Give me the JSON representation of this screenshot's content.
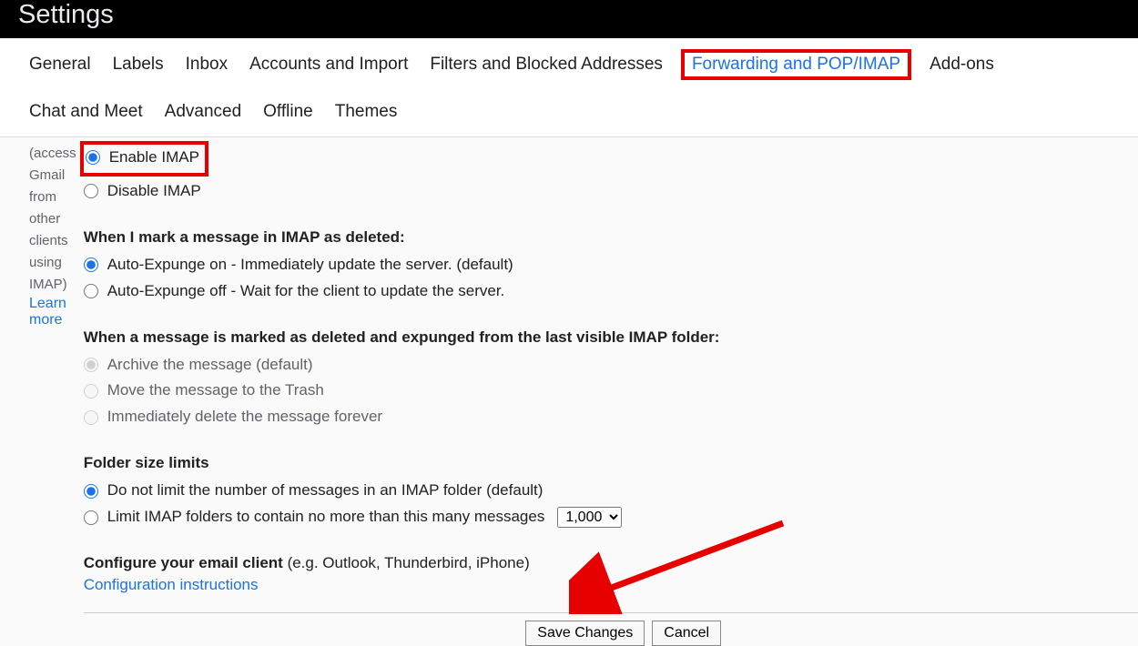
{
  "header": {
    "title": "Settings"
  },
  "tabs": {
    "general": "General",
    "labels": "Labels",
    "inbox": "Inbox",
    "accounts": "Accounts and Import",
    "filters": "Filters and Blocked Addresses",
    "forwarding": "Forwarding and POP/IMAP",
    "addons": "Add-ons",
    "chat": "Chat and Meet",
    "advanced": "Advanced",
    "offline": "Offline",
    "themes": "Themes"
  },
  "left": {
    "hint": "(access Gmail from other clients using IMAP)",
    "learn": "Learn more"
  },
  "imap_access": {
    "enable": "Enable IMAP",
    "disable": "Disable IMAP"
  },
  "expunge": {
    "title": "When I mark a message in IMAP as deleted:",
    "on": "Auto-Expunge on - Immediately update the server. (default)",
    "off": "Auto-Expunge off - Wait for the client to update the server."
  },
  "last_folder": {
    "title": "When a message is marked as deleted and expunged from the last visible IMAP folder:",
    "archive": "Archive the message (default)",
    "trash": "Move the message to the Trash",
    "delete": "Immediately delete the message forever"
  },
  "folder_limits": {
    "title": "Folder size limits",
    "nolimit": "Do not limit the number of messages in an IMAP folder (default)",
    "limit": "Limit IMAP folders to contain no more than this many messages",
    "select_value": "1,000"
  },
  "configure": {
    "bold": "Configure your email client",
    "rest": " (e.g. Outlook, Thunderbird, iPhone)",
    "link": "Configuration instructions"
  },
  "buttons": {
    "save": "Save Changes",
    "cancel": "Cancel"
  }
}
